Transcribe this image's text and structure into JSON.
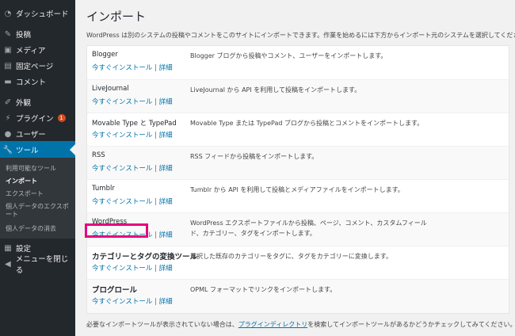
{
  "sidebar": {
    "dashboard": "ダッシュボード",
    "posts": "投稿",
    "media": "メディア",
    "pages": "固定ページ",
    "comments": "コメント",
    "appearance": "外観",
    "plugins": "プラグイン",
    "plugins_badge": "1",
    "users": "ユーザー",
    "tools": "ツール",
    "tools_sub": {
      "available": "利用可能なツール",
      "import": "インポート",
      "export": "エクスポート",
      "export_personal": "個人データのエクスポート",
      "erase_personal": "個人データの消去"
    },
    "settings": "設定",
    "collapse": "メニューを閉じる"
  },
  "main": {
    "title": "インポート",
    "intro": "WordPress は別のシステムの投稿やコメントをこのサイトにインポートできます。作業を始めるには下方からインポート元のシステムを選択してください。",
    "action_install": "今すぐインストール",
    "action_sep": "|",
    "action_details": "詳細",
    "importers": [
      {
        "name": "Blogger",
        "desc": "Blogger ブログから投稿やコメント、ユーザーをインポートします。"
      },
      {
        "name": "LiveJournal",
        "desc": "LiveJournal から API を利用して投稿をインポートします。"
      },
      {
        "name": "Movable Type と TypePad",
        "desc": "Movable Type または TypePad ブログから投稿とコメントをインポートします。"
      },
      {
        "name": "RSS",
        "desc": "RSS フィードから投稿をインポートします。"
      },
      {
        "name": "Tumblr",
        "desc": "Tumblr から API を利用して投稿とメディアファイルをインポートします。"
      },
      {
        "name": "WordPress",
        "desc": "WordPress エクスポートファイルから投稿、ページ、コメント、カスタムフィールド、カテゴリー、タグをインポートします。"
      },
      {
        "name": "カテゴリーとタグの変換ツール",
        "desc": "選択した既存のカテゴリーをタグに、タグをカテゴリーに変換します。"
      },
      {
        "name": "ブログロール",
        "desc": "OPML フォーマットでリンクをインポートします。"
      }
    ],
    "footer_before": "必要なインポートツールが表示されていない場合は、",
    "footer_link": "プラグインディレクトリ",
    "footer_after": "を検索してインポートツールがあるかどうかチェックしてみてください。"
  },
  "colors": {
    "sidebar_bg": "#23282d",
    "active": "#0073aa",
    "highlight_box": "#e6007e",
    "link": "#0073aa"
  }
}
